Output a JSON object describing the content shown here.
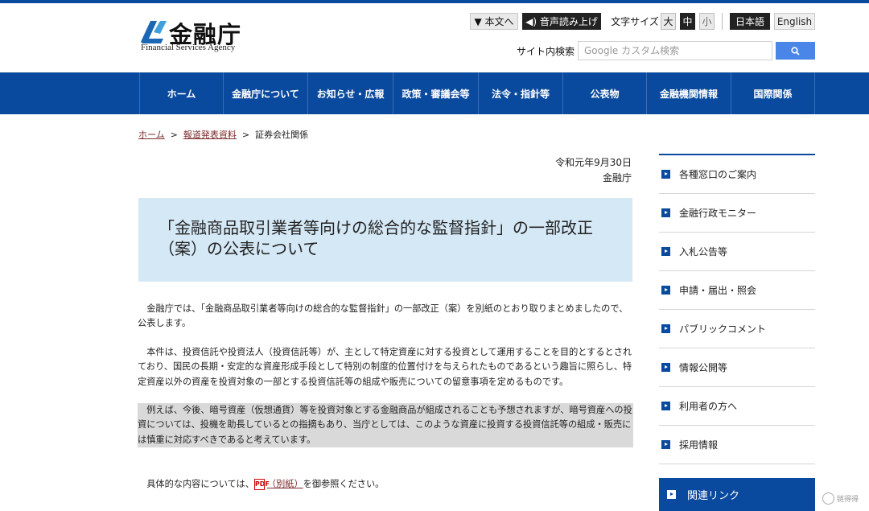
{
  "header": {
    "logo_name": "金融庁",
    "logo_sub": "Financial Services Agency",
    "honbun_label": "▼ 本文へ",
    "voice_label": "◀) 音声読み上げ",
    "fontsize_label": "文字サイズ",
    "fontsize_large": "大",
    "fontsize_medium": "中",
    "fontsize_small": "小",
    "lang_ja": "日本語",
    "lang_en": "English",
    "search_label": "サイト内検索",
    "search_placeholder": "Google カスタム検索"
  },
  "nav": {
    "items": [
      {
        "label": "ホーム"
      },
      {
        "label": "金融庁について"
      },
      {
        "label": "お知らせ・広報"
      },
      {
        "label": "政策・審議会等"
      },
      {
        "label": "法令・指針等"
      },
      {
        "label": "公表物"
      },
      {
        "label": "金融機関情報"
      },
      {
        "label": "国際関係"
      }
    ]
  },
  "breadcrumb": {
    "home": "ホーム",
    "sep": ">",
    "press": "報道発表資料",
    "current": "証券会社関係"
  },
  "main": {
    "date": "令和元年9月30日",
    "org": "金融庁",
    "title": "「金融商品取引業者等向けの総合的な監督指針」の一部改正（案）の公表について",
    "p1": "　金融庁では、「金融商品取引業者等向けの総合的な監督指針」の一部改正（案）を別紙のとおり取りまとめましたので、公表します。",
    "p2": "　本件は、投資信託や投資法人（投資信託等）が、主として特定資産に対する投資として運用することを目的とするとされており、国民の長期・安定的な資産形成手段として特別の制度的位置付けを与えられたものであるという趣旨に照らし、特定資産以外の資産を投資対象の一部とする投資信託等の組成や販売についての留意事項を定めるものです。",
    "p3": "　例えば、今後、暗号資産（仮想通貨）等を投資対象とする金融商品が組成されることも予想されますが、暗号資産への投資については、投機を助長しているとの指摘もあり、当庁としては、このような資産に投資する投資信託等の組成・販売には慎重に対応すべきであると考えています。",
    "p4_before": "　具体的な内容については、",
    "pdf_icon": "PDF",
    "p4_link": "（別紙）",
    "p4_after": "を御参照ください。"
  },
  "side": {
    "items": [
      {
        "label": "各種窓口のご案内"
      },
      {
        "label": "金融行政モニター"
      },
      {
        "label": "入札公告等"
      },
      {
        "label": "申請・届出・照会"
      },
      {
        "label": "パブリックコメント"
      },
      {
        "label": "情報公開等"
      },
      {
        "label": "利用者の方へ"
      },
      {
        "label": "採用情報"
      }
    ],
    "related": "関連リンク"
  },
  "watermark": "链得得",
  "colors": {
    "brand_blue": "#0a4a9e",
    "title_bg": "#d5e8f6",
    "search_button": "#4a86e8",
    "link": "#7b2a2a"
  }
}
